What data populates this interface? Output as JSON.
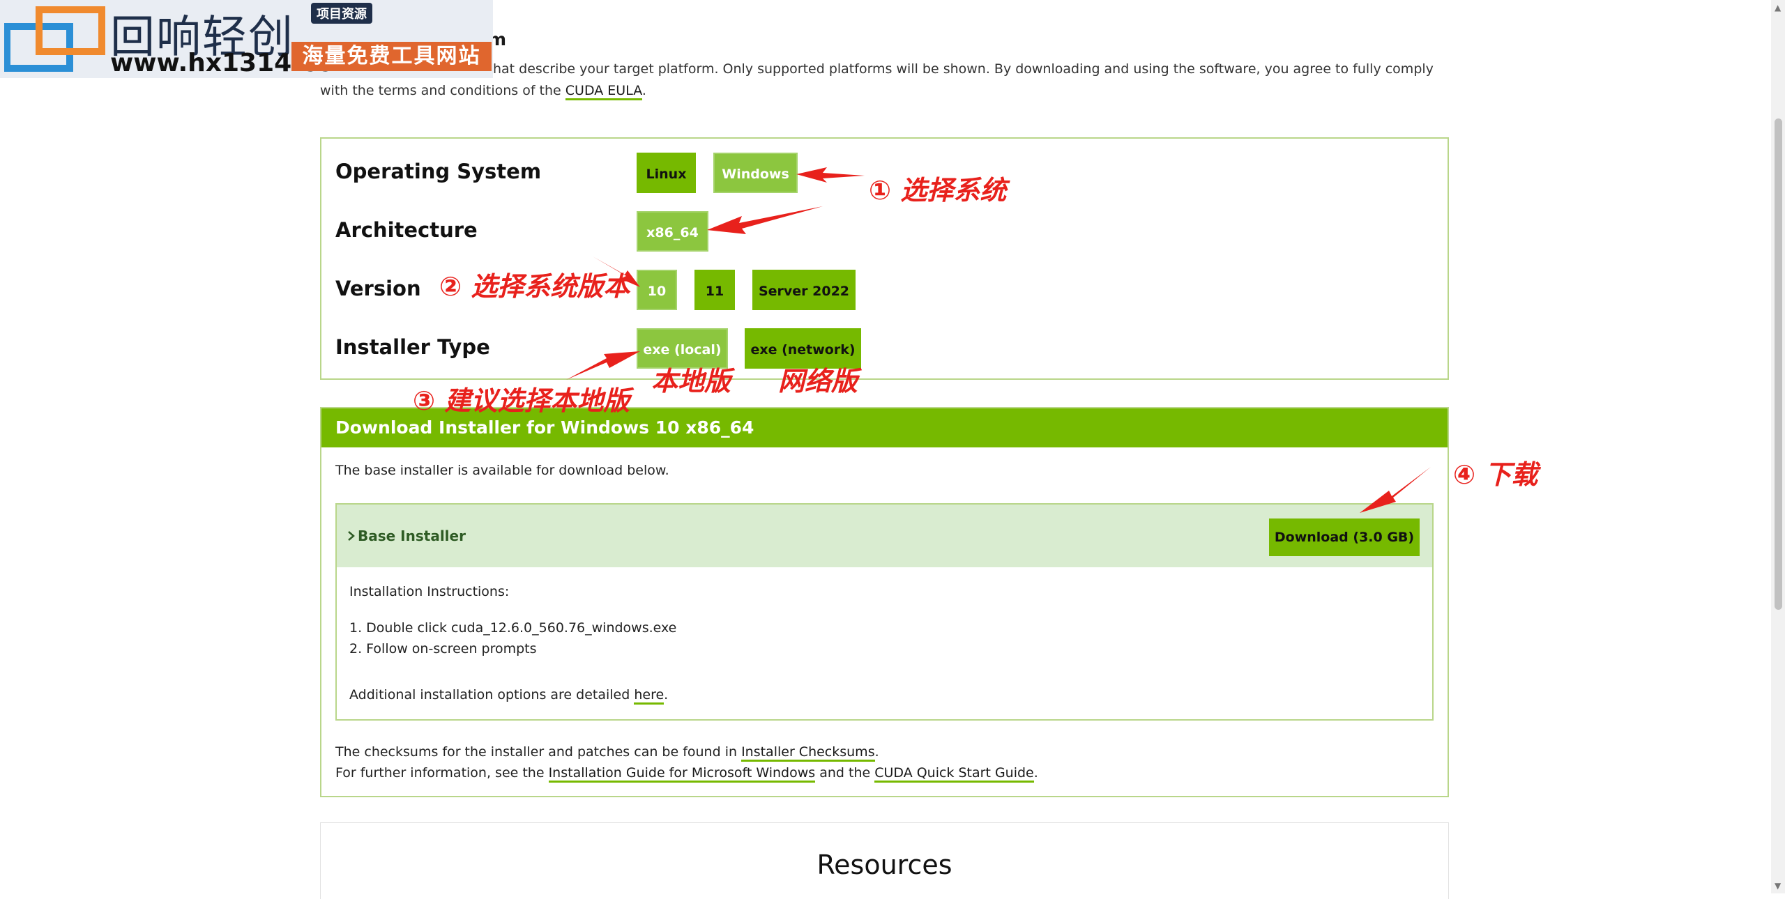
{
  "watermark": {
    "brand": "回响轻创",
    "tag": "项目资源",
    "url": "www.hx1314.cc",
    "slogan": "海量免费工具网站"
  },
  "intro": {
    "heading_fragment": "m",
    "text_part1": "hat describe your target platform. Only supported platforms will be shown. By downloading and using the software, you agree to fully comply with the terms and conditions of the ",
    "eula_link": "CUDA EULA",
    "text_end": "."
  },
  "selector": {
    "rows": [
      {
        "label": "Operating System",
        "options": [
          "Linux",
          "Windows"
        ],
        "selected": "Windows"
      },
      {
        "label": "Architecture",
        "options": [
          "x86_64"
        ],
        "selected": "x86_64"
      },
      {
        "label": "Version",
        "options": [
          "10",
          "11",
          "Server 2022"
        ],
        "selected": "10"
      },
      {
        "label": "Installer Type",
        "options": [
          "exe (local)",
          "exe (network)"
        ],
        "selected": "exe (local)"
      }
    ]
  },
  "download": {
    "header": "Download Installer for Windows 10 x86_64",
    "available": "The base installer is available for download below.",
    "base_installer_title": "Base Installer",
    "download_button": "Download (3.0 GB)",
    "instructions_title": "Installation Instructions:",
    "steps": [
      "1. Double click cuda_12.6.0_560.76_windows.exe",
      "2. Follow on-screen prompts"
    ],
    "more_prefix": "Additional installation options are detailed ",
    "more_link": "here",
    "more_suffix": ".",
    "checksum_prefix": "The checksums for the installer and patches can be found in ",
    "checksum_link": "Installer Checksums",
    "checksum_suffix": ".",
    "info_prefix": "For further information, see the ",
    "info_link1": "Installation Guide for Microsoft Windows",
    "info_mid": " and the ",
    "info_link2": "CUDA Quick Start Guide",
    "info_suffix": "."
  },
  "resources": {
    "title": "Resources"
  },
  "annotations": {
    "a1": "① 选择系统",
    "a2": "② 选择系统版本",
    "a3": "③ 建议选择本地版",
    "a_local": "本地版",
    "a_network": "网络版",
    "a4": "④ 下载"
  },
  "colors": {
    "accent": "#76b900",
    "accent_selected": "#8cc63f",
    "annotation": "#e8211c"
  },
  "icons": {
    "chevron": "chevron-right-icon"
  }
}
